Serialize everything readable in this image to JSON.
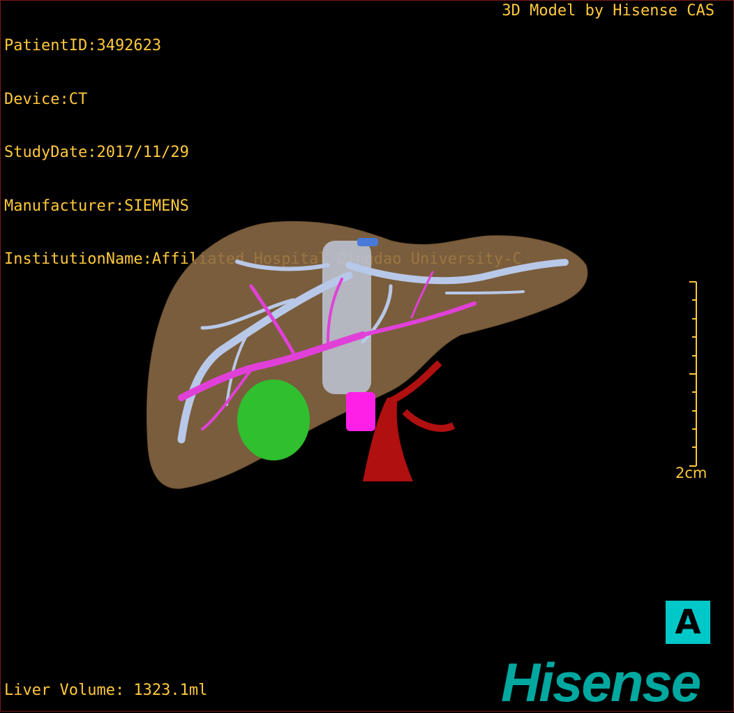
{
  "overlay": {
    "patient_id": "PatientID:3492623",
    "device": "Device:CT",
    "study_date": "StudyDate:2017/11/29",
    "manufacturer": "Manufacturer:SIEMENS",
    "institution": "InstitutionName:Affiliated Hospital Qingdao University-C",
    "model_credit": "3D Model by Hisense CAS",
    "liver_volume": "Liver Volume: 1323.1ml"
  },
  "scale_bar": {
    "label": "2cm"
  },
  "orientation_marker": {
    "label": "A"
  },
  "brand": {
    "logo_text": "Hisense",
    "color": "#00a8a0"
  },
  "colors": {
    "overlay_text": "#ffc93c",
    "liver": "#8b6a44",
    "hepatic_vein": "#b8c8e8",
    "portal_vein": "#e040d8",
    "tumor": "#2fbf2f",
    "artery": "#b01010",
    "orientation_bg": "#00c8c8"
  }
}
